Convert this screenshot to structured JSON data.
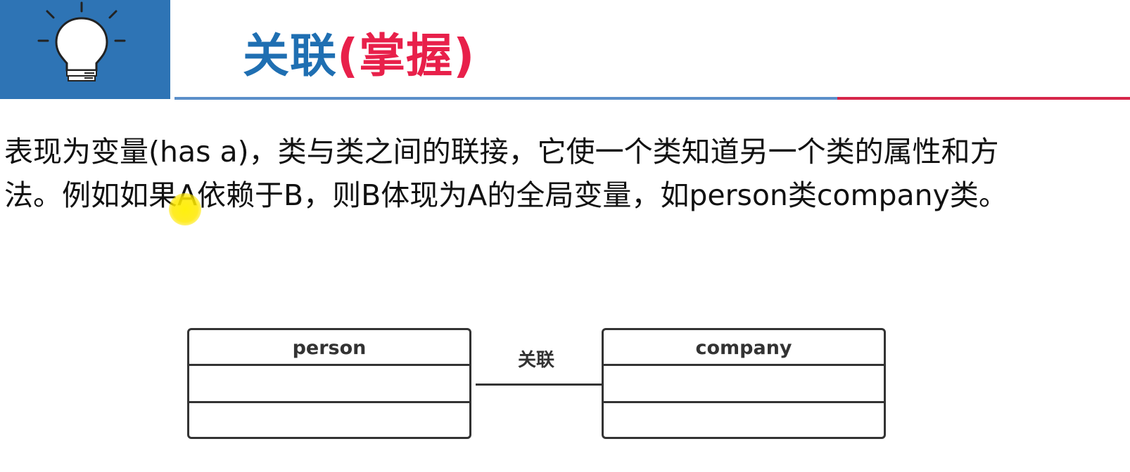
{
  "header": {
    "title_main": "关联",
    "title_sub": "(掌握)",
    "icon": "lightbulb-icon",
    "colors": {
      "logo_bg": "#2e74b5",
      "title_main": "#1f6fb2",
      "title_sub": "#e8204a",
      "rule_blue": "#5b8fc9",
      "rule_red": "#d6264a"
    }
  },
  "description": {
    "line1": "表现为变量(has a)，类与类之间的联接，它使一个类知道另一个类的属性和方",
    "line2": "法。例如如果A依赖于B，则B体现为A的全局变量，如person类company类。"
  },
  "diagram": {
    "classes": [
      {
        "name": "person"
      },
      {
        "name": "company"
      }
    ],
    "relation_label": "关联"
  }
}
